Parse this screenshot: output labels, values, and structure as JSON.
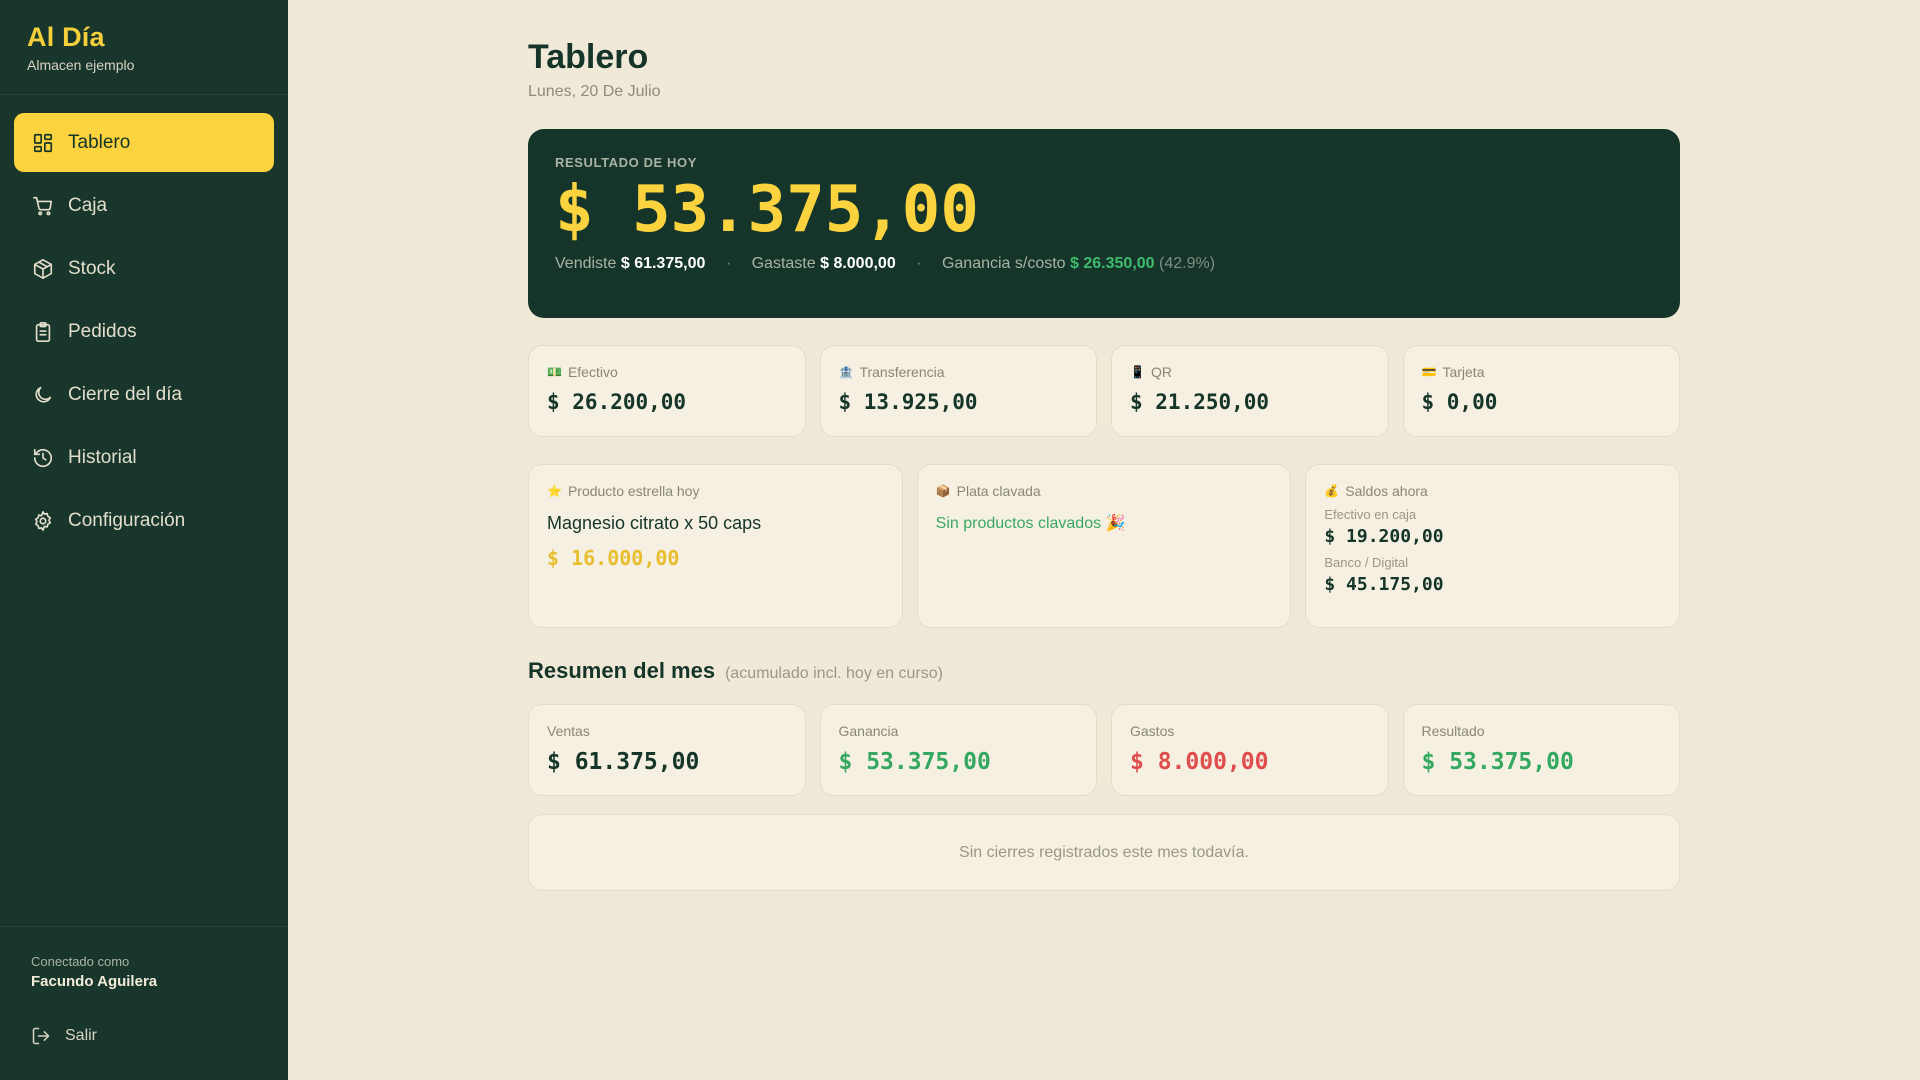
{
  "brand": {
    "title": "Al Día",
    "subtitle": "Almacen ejemplo"
  },
  "nav": [
    {
      "label": "Tablero",
      "icon": "grid-icon",
      "active": true
    },
    {
      "label": "Caja",
      "icon": "cart-icon"
    },
    {
      "label": "Stock",
      "icon": "box-icon"
    },
    {
      "label": "Pedidos",
      "icon": "clipboard-icon"
    },
    {
      "label": "Cierre del día",
      "icon": "moon-icon"
    },
    {
      "label": "Historial",
      "icon": "history-icon"
    },
    {
      "label": "Configuración",
      "icon": "gear-icon"
    }
  ],
  "footer": {
    "connected_label": "Conectado como",
    "user": "Facundo Aguilera",
    "logout": "Salir"
  },
  "header": {
    "title": "Tablero",
    "date": "Lunes, 20 De Julio"
  },
  "hero": {
    "label": "RESULTADO DE HOY",
    "amount": "$ 53.375,00",
    "sold_label": "Vendiste",
    "sold_value": "$ 61.375,00",
    "spent_label": "Gastaste",
    "spent_value": "$ 8.000,00",
    "profit_label": "Ganancia s/costo",
    "profit_value": "$ 26.350,00",
    "profit_pct": "(42.9%)",
    "separator": "·"
  },
  "payments": [
    {
      "label": "Efectivo",
      "emoji": "💵",
      "value": "$ 26.200,00"
    },
    {
      "label": "Transferencia",
      "emoji": "🏦",
      "value": "$ 13.925,00"
    },
    {
      "label": "QR",
      "emoji": "📱",
      "value": "$ 21.250,00"
    },
    {
      "label": "Tarjeta",
      "emoji": "💳",
      "value": "$ 0,00"
    }
  ],
  "star": {
    "label": "Producto estrella hoy",
    "emoji": "⭐",
    "name": "Magnesio citrato x 50 caps",
    "value": "$ 16.000,00"
  },
  "plata": {
    "label": "Plata clavada",
    "emoji": "📦",
    "message": "Sin productos clavados 🎉"
  },
  "saldos": {
    "label": "Saldos ahora",
    "emoji": "💰",
    "cash_label": "Efectivo en caja",
    "cash_value": "$ 19.200,00",
    "bank_label": "Banco / Digital",
    "bank_value": "$ 45.175,00"
  },
  "month": {
    "title": "Resumen del mes",
    "subtitle": "(acumulado incl. hoy en curso)",
    "cards": [
      {
        "label": "Ventas",
        "value": "$ 61.375,00",
        "tone": "default"
      },
      {
        "label": "Ganancia",
        "value": "$ 53.375,00",
        "tone": "green"
      },
      {
        "label": "Gastos",
        "value": "$ 8.000,00",
        "tone": "red"
      },
      {
        "label": "Resultado",
        "value": "$ 53.375,00",
        "tone": "green"
      }
    ],
    "empty": "Sin cierres registrados este mes todavía."
  },
  "colors": {
    "sidebar": "#18362b",
    "accent": "#fbd33e",
    "background": "#f0e9d8",
    "positive": "#34a860",
    "negative": "#e04d4d"
  }
}
